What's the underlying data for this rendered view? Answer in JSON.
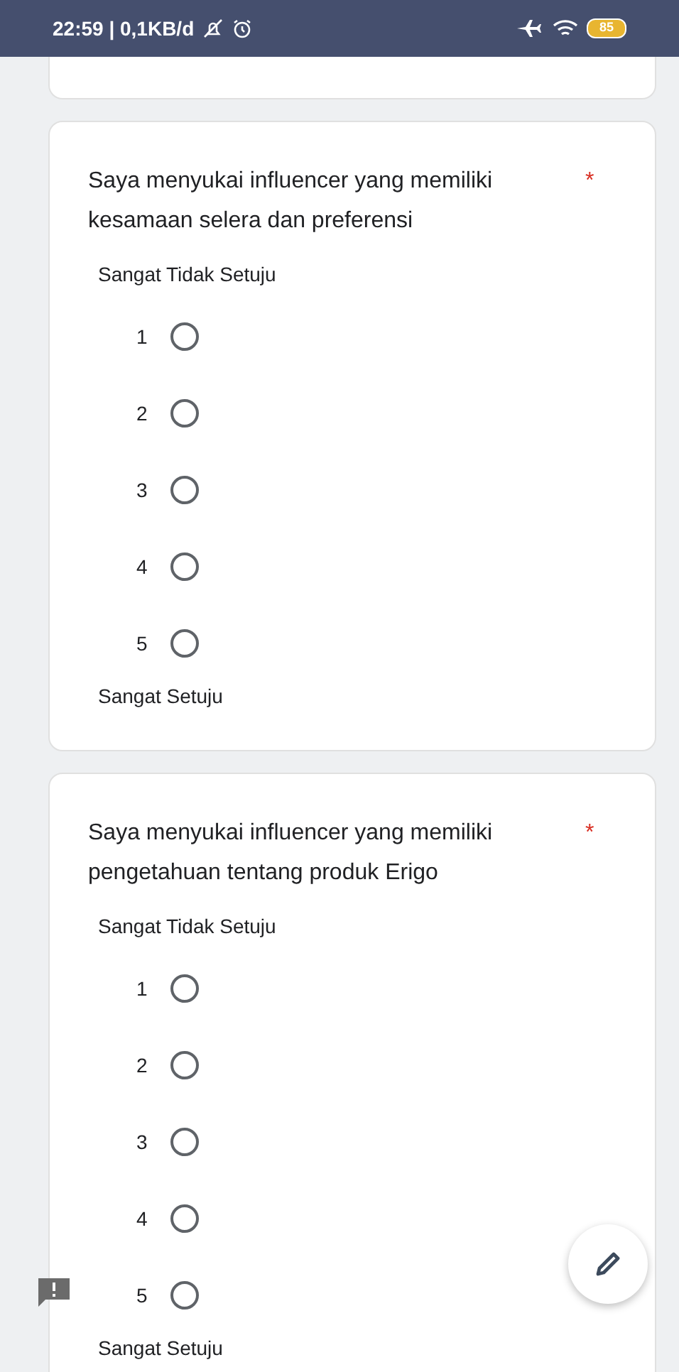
{
  "status_bar": {
    "time": "22:59 | 0,1KB/d",
    "battery": "85"
  },
  "questions": [
    {
      "title": "Saya menyukai influencer yang memiliki kesamaan selera dan preferensi",
      "required": true,
      "required_mark": "*",
      "low_label": "Sangat Tidak Setuju",
      "high_label": "Sangat Setuju",
      "options": [
        {
          "label": "1",
          "selected": false
        },
        {
          "label": "2",
          "selected": false
        },
        {
          "label": "3",
          "selected": false
        },
        {
          "label": "4",
          "selected": false
        },
        {
          "label": "5",
          "selected": false
        }
      ]
    },
    {
      "title": "Saya menyukai influencer yang memiliki pengetahuan tentang produk Erigo",
      "required": true,
      "required_mark": "*",
      "low_label": "Sangat Tidak Setuju",
      "high_label": "Sangat Setuju",
      "options": [
        {
          "label": "1",
          "selected": false
        },
        {
          "label": "2",
          "selected": false
        },
        {
          "label": "3",
          "selected": false
        },
        {
          "label": "4",
          "selected": false
        },
        {
          "label": "5",
          "selected": false
        }
      ]
    }
  ]
}
